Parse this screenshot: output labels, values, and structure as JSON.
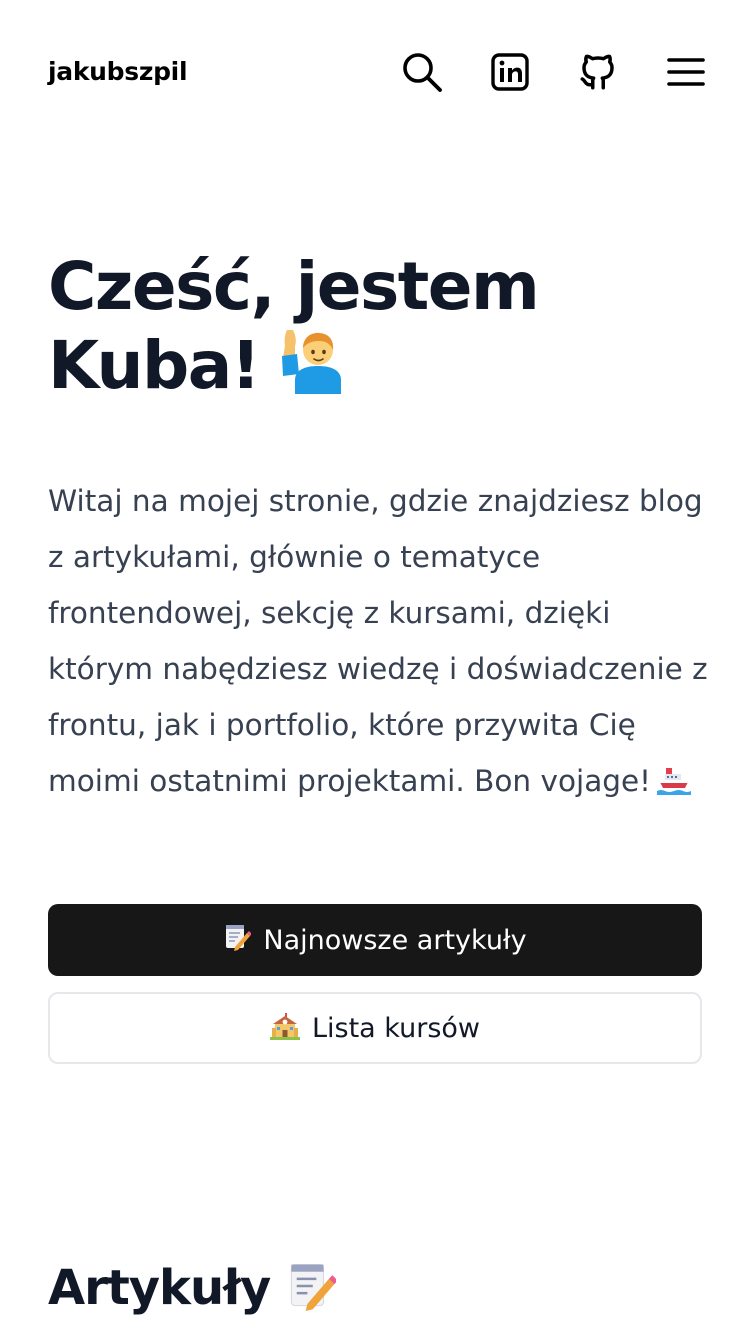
{
  "header": {
    "brand": "jakubszpil",
    "icons": [
      "search-icon",
      "linkedin-icon",
      "github-icon",
      "menu-icon"
    ]
  },
  "hero": {
    "title_line1": "Cześć, jestem",
    "title_line2": "Kuba!",
    "intro": "Witaj na mojej stronie, gdzie znajdziesz blog z artykułami, głównie o tematyce frontendowej, sekcję z kursami, dzięki którym nabędziesz wiedzę i doświadczenie z frontu, jak i portfolio, które przywita Cię moimi ostatnimi projektami. Bon vojage!"
  },
  "buttons": {
    "articles_label": "Najnowsze artykuły",
    "courses_label": "Lista kursów"
  },
  "articles_section": {
    "title": "Artykuły"
  },
  "colors": {
    "text_primary": "#111827",
    "text_body": "#374151",
    "button_dark": "#171717",
    "button_border": "#e5e7eb"
  }
}
